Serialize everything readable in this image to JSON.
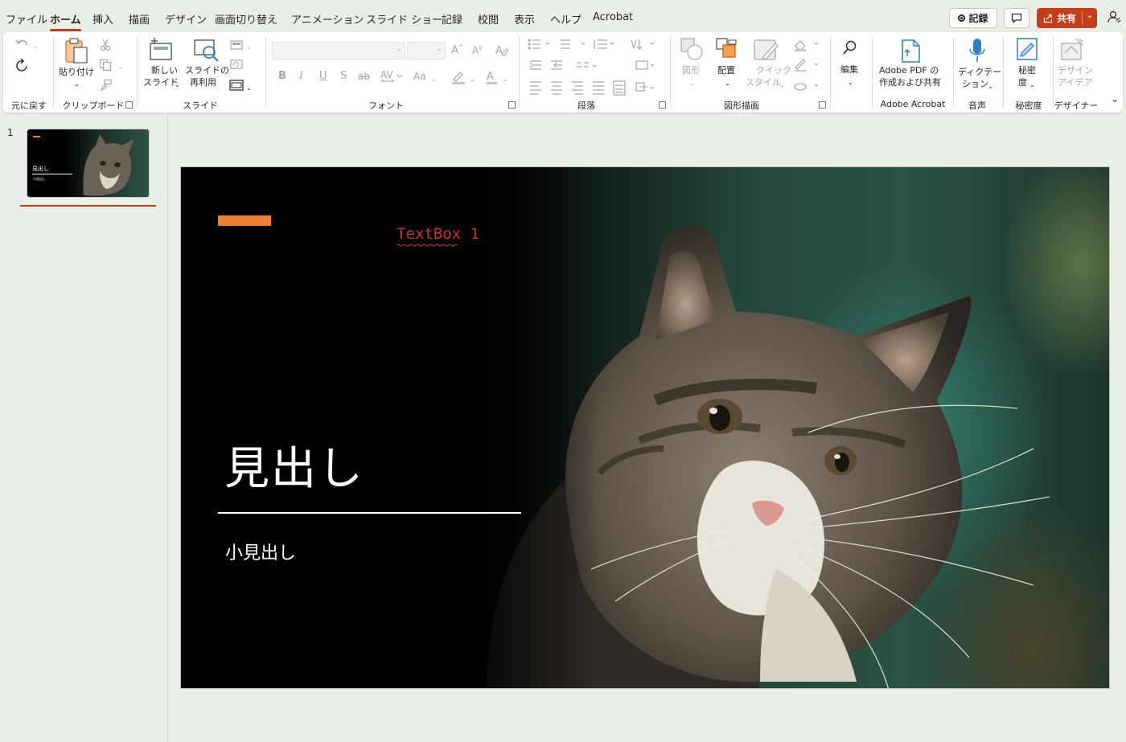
{
  "menu": {
    "tabs": [
      "ファイル",
      "ホーム",
      "挿入",
      "描画",
      "デザイン",
      "画面切り替え",
      "アニメーション",
      "スライド ショー",
      "記録",
      "校閲",
      "表示",
      "ヘルプ",
      "Acrobat"
    ],
    "active_tab": "ホーム",
    "record_label": "記録",
    "share_label": "共有"
  },
  "ribbon": {
    "undo": {
      "label": "元に戻す"
    },
    "clipboard": {
      "paste": "貼り付け",
      "label": "クリップボード"
    },
    "slides": {
      "new_slide_1": "新しい",
      "new_slide_2": "スライド",
      "reuse_1": "スライドの",
      "reuse_2": "再利用",
      "label": "スライド"
    },
    "font": {
      "label": "フォント",
      "bold": "B",
      "italic": "I",
      "underline": "U",
      "shadow": "S",
      "strike": "ab",
      "case": "Aa"
    },
    "paragraph": {
      "label": "段落"
    },
    "drawing": {
      "shape_label": "図形",
      "arrange_label": "配置",
      "quick_1": "クイック",
      "quick_2": "スタイル",
      "label": "図形描画"
    },
    "editing": {
      "label": "編集"
    },
    "acrobat": {
      "btn_1": "Adobe PDF の",
      "btn_2": "作成および共有",
      "label": "Adobe Acrobat"
    },
    "voice": {
      "btn_1": "ディクテー",
      "btn_2": "ション",
      "label": "音声"
    },
    "sensitivity": {
      "btn_1": "秘密",
      "btn_2": "度",
      "label": "秘密度"
    },
    "designer": {
      "btn_1": "デザイン",
      "btn_2": "アイデア",
      "label": "デザイナー"
    }
  },
  "thumbnails": [
    {
      "number": "1",
      "title": "見出し",
      "subtitle": "小見出し"
    }
  ],
  "slide": {
    "textbox": "TextBox 1",
    "title": "見出し",
    "subtitle": "小見出し"
  },
  "colors": {
    "accent": "#c43e1c",
    "slide_accent_bar": "#ed7d31",
    "textbox_text": "#c0392b"
  }
}
